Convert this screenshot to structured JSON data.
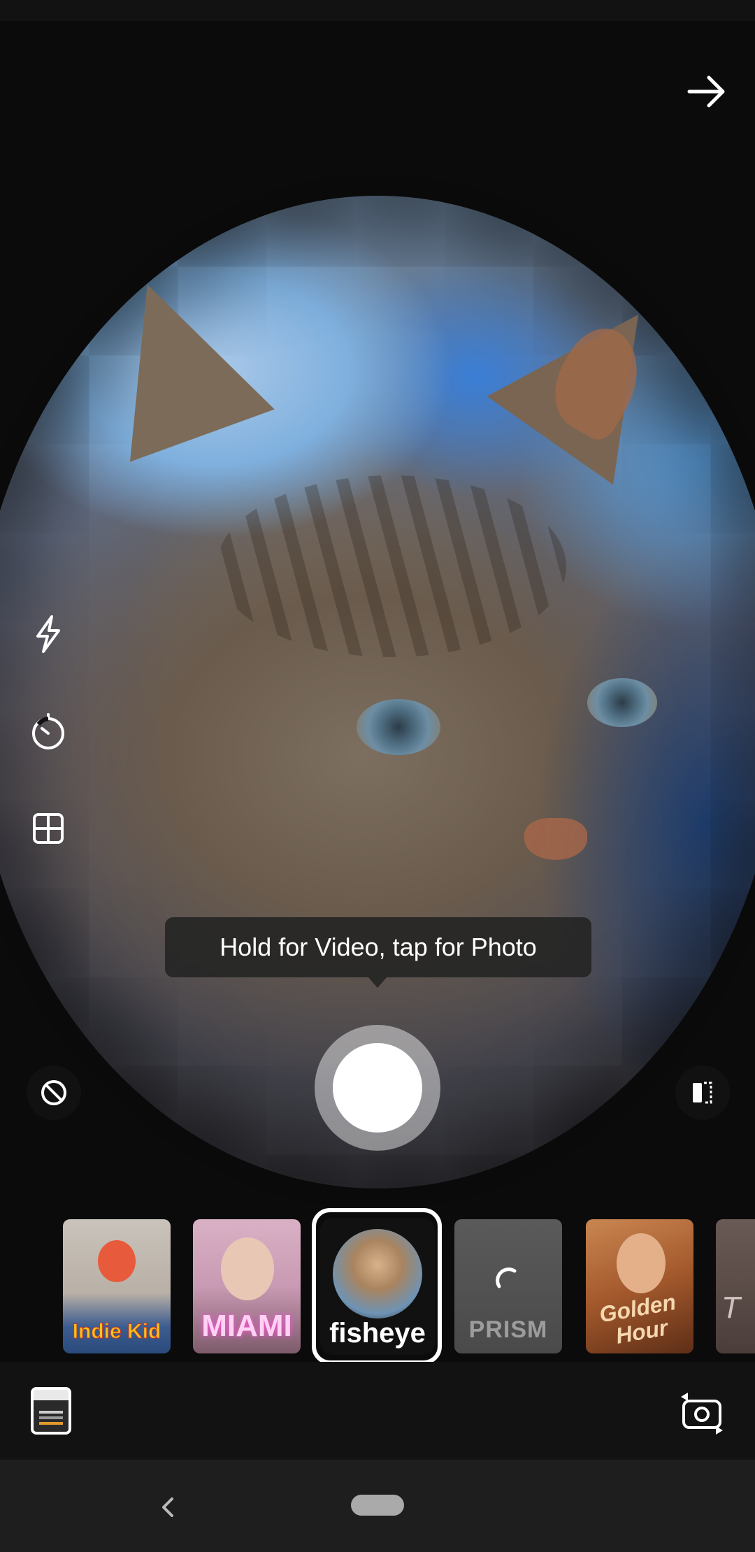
{
  "camera": {
    "tooltip": "Hold for Video, tap for Photo"
  },
  "controls": {
    "next": "arrow-right-icon",
    "flash": "flash-icon",
    "timer": "timer-icon",
    "layout": "layout-grid-icon",
    "no_effect": "no-effect-icon",
    "mirror": "mirror-icon",
    "gallery": "gallery-thumbnail",
    "flip_camera": "flip-camera-icon"
  },
  "effects": [
    {
      "label": "Indie Kid",
      "selected": false
    },
    {
      "label": "MIAMI",
      "selected": false
    },
    {
      "label": "fisheye",
      "selected": true
    },
    {
      "label": "PRISM",
      "selected": false,
      "loading": true
    },
    {
      "label": "Golden Hour",
      "selected": false
    },
    {
      "label": "T",
      "selected": false
    }
  ],
  "colors": {
    "background": "#121212",
    "tooltip_bg": "#262626",
    "white": "#ffffff"
  }
}
